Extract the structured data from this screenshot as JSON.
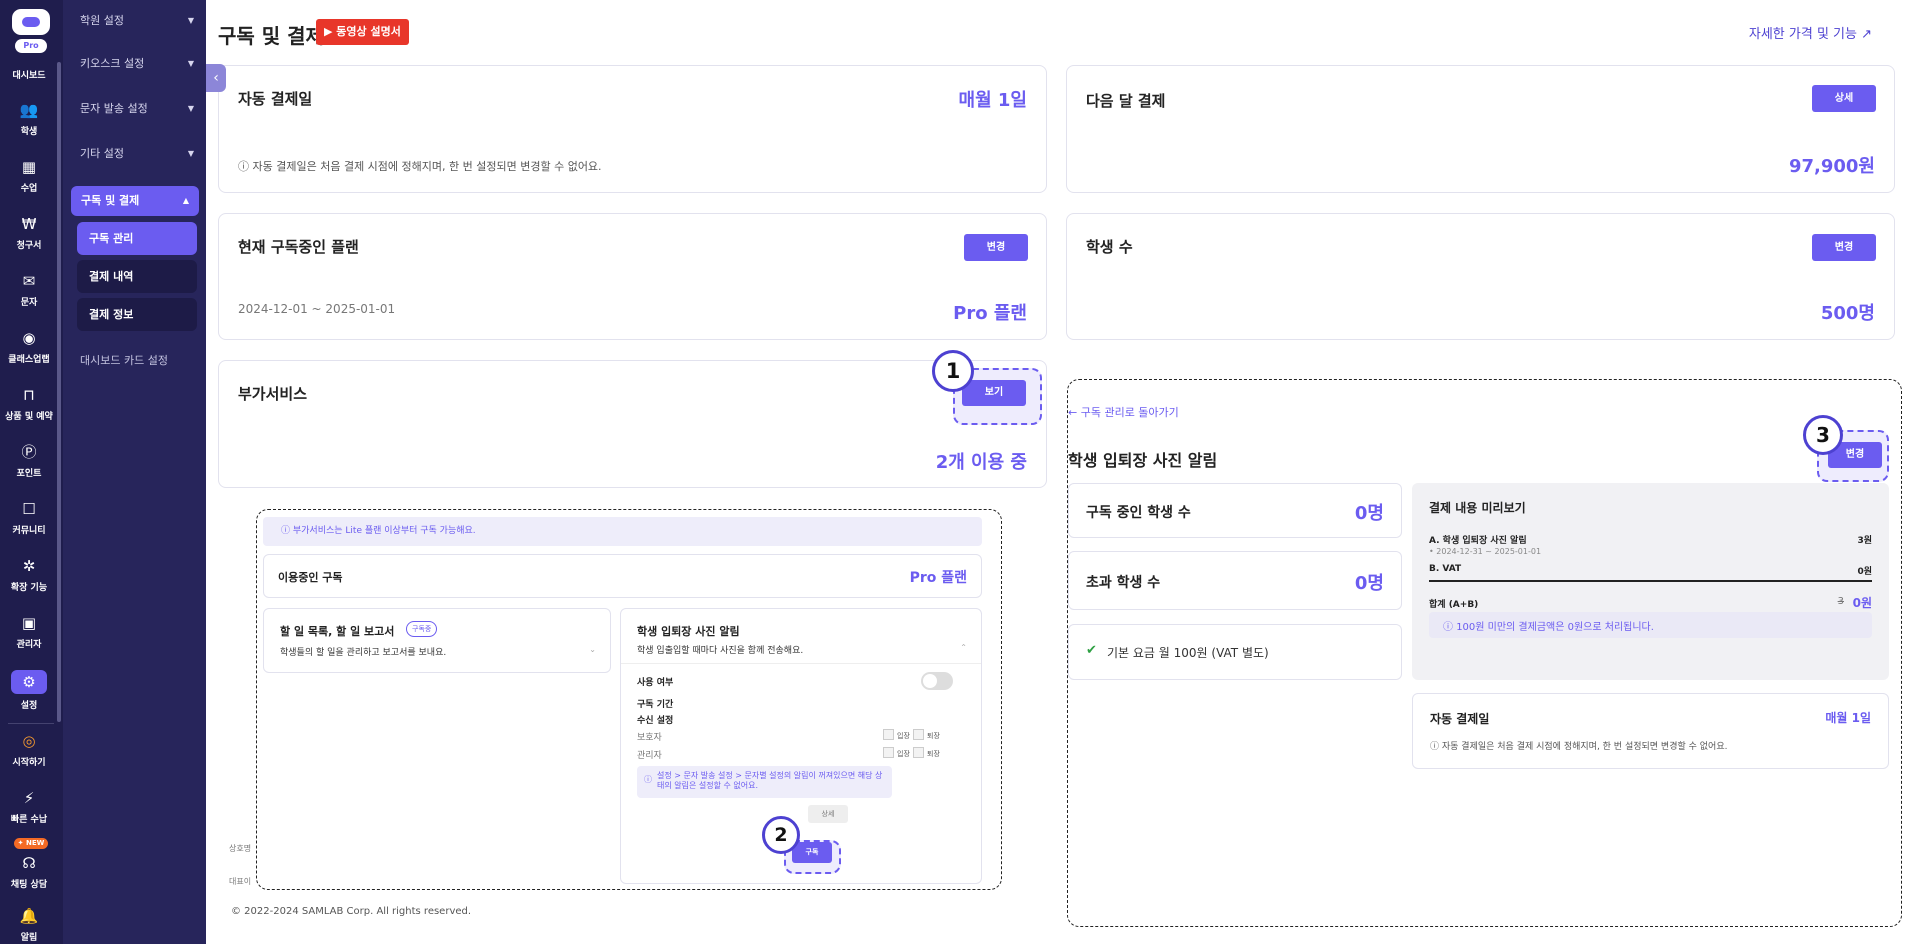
{
  "rail": {
    "pro": "Pro",
    "items": [
      {
        "label": "대시보드",
        "icon": "grid-icon"
      },
      {
        "label": "학생",
        "icon": "users-icon",
        "glyph": "👥"
      },
      {
        "label": "수업",
        "icon": "calendar-icon",
        "glyph": "▦"
      },
      {
        "label": "청구서",
        "icon": "won-icon",
        "glyph": "₩"
      },
      {
        "label": "문자",
        "icon": "mail-icon",
        "glyph": "✉"
      },
      {
        "label": "클래스업랩",
        "icon": "webcam-icon",
        "glyph": "◉"
      },
      {
        "label": "상품 및 예약",
        "icon": "bag-icon",
        "glyph": "⊓"
      },
      {
        "label": "포인트",
        "icon": "point-icon",
        "glyph": "Ⓟ"
      },
      {
        "label": "커뮤니티",
        "icon": "chat-icon",
        "glyph": "☐"
      },
      {
        "label": "확장 기능",
        "icon": "puzzle-icon",
        "glyph": "✲"
      },
      {
        "label": "관리자",
        "icon": "admin-icon",
        "glyph": "▣"
      },
      {
        "label": "설정",
        "icon": "gear-icon",
        "glyph": "⚙"
      },
      {
        "label": "시작하기",
        "icon": "start-icon",
        "glyph": "◎"
      },
      {
        "label": "빠른 수납",
        "icon": "bolt-icon",
        "glyph": "⚡"
      },
      {
        "label": "채팅 상담",
        "icon": "headset-icon",
        "glyph": "☊"
      },
      {
        "label": "알림",
        "icon": "bell-icon",
        "glyph": "🔔"
      }
    ],
    "new_badge": "✦ NEW"
  },
  "nav": {
    "groups": [
      "학원 설정",
      "키오스크 설정",
      "문자 발송 설정",
      "기타 설정"
    ],
    "active": "구독 및 결제",
    "subs": [
      "구독 관리",
      "결제 내역",
      "결제 정보"
    ],
    "dash": "대시보드 카드 설정"
  },
  "header": {
    "title": "구독 및 결제",
    "video": "동영상 설명서",
    "detail": "자세한 가격 및 기능"
  },
  "auto_pay": {
    "label": "자동 결제일",
    "value": "매월 1일",
    "note": "자동 결제일은 처음 결제 시점에 정해지며, 한 번 설정되면 변경할 수 없어요."
  },
  "next_pay": {
    "label": "다음 달 결제",
    "button": "상세",
    "value": "97,900원"
  },
  "plan": {
    "label": "현재 구독중인 플랜",
    "button": "변경",
    "period": "2024-12-01 ~ 2025-01-01",
    "value": "Pro 플랜"
  },
  "students": {
    "label": "학생 수",
    "button": "변경",
    "value": "500명"
  },
  "addon": {
    "label": "부가서비스",
    "button": "보기",
    "value": "2개 이용 중"
  },
  "markers": [
    "1",
    "2",
    "3"
  ],
  "shot1": {
    "banner": "부가서비스는 Lite 플랜 이상부터 구독 가능해요.",
    "using": "이용중인 구독",
    "plan": "Pro 플랜",
    "todo_title": "할 일 목록, 할 일 보고서",
    "todo_badge": "구독중",
    "todo_desc": "학생들의 할 일을 관리하고 보고서를 보내요.",
    "photo_title": "학생 입퇴장 사진 알림",
    "photo_desc": "학생 입출입할 때마다 사진을 함께 전송해요.",
    "use": "사용 여부",
    "period": "구독 기간",
    "recv": "수신 설정",
    "guardian": "보호자",
    "admin": "관리자",
    "in": "입장",
    "out": "퇴장",
    "warn": "설정 > 문자 발송 설정 > 문자별 설정의 알림이 꺼져있으면 해당 상태의 알림은 설정할 수 없어요.",
    "detail_btn": "상세",
    "sub_btn": "구독",
    "side1": "상호명",
    "side2": "대표이"
  },
  "footer": "© 2022-2024 SAMLAB Corp. All rights reserved.",
  "shot2": {
    "back": "구독 관리로 돌아가기",
    "title": "학생 입퇴장 사진 알림",
    "change": "변경",
    "subscribed_label": "구독 중인 학생 수",
    "subscribed_value": "0명",
    "over_label": "초과 학생 수",
    "over_value": "0명",
    "base_fee": "기본 요금 월 100원 (VAT 별도)",
    "preview_title": "결제 내용 미리보기",
    "line_a": "A. 학생 입퇴장 사진 알림",
    "line_a_value": "3원",
    "line_a_period": "2024-12-31 ~ 2025-01-01",
    "line_b": "B. VAT",
    "line_b_value": "0원",
    "total": "합계 (A+B)",
    "total_strike": "3",
    "total_value": "0원",
    "total_note": "100원 미만의 결제금액은 0원으로 처리됩니다.",
    "auto_label": "자동 결제일",
    "auto_value": "매월 1일",
    "auto_note": "자동 결제일은 처음 결제 시점에 정해지며, 한 번 설정되면 변경할 수 없어요."
  }
}
